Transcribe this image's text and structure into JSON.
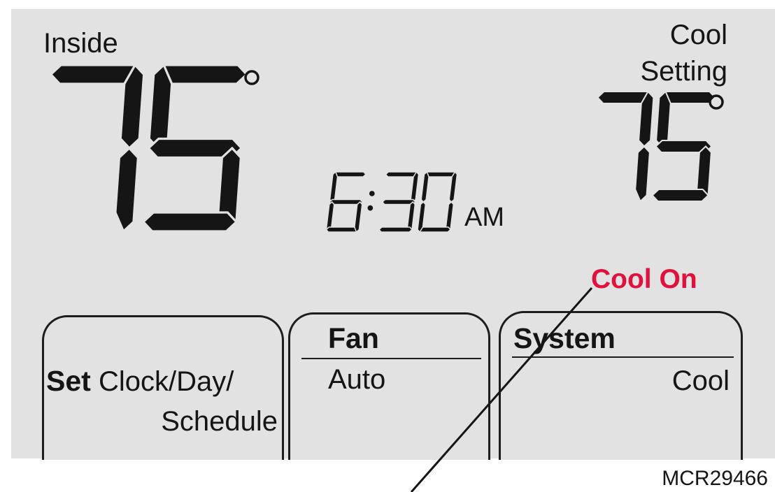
{
  "inside": {
    "label": "Inside",
    "temperature": "75",
    "degree_symbol": "°"
  },
  "cool_setting": {
    "label_line1": "Cool",
    "label_line2": "Setting",
    "temperature": "75",
    "degree_symbol": "°"
  },
  "clock": {
    "time": "6:30",
    "meridiem": "AM"
  },
  "status": {
    "text": "Cool On",
    "color": "#e0113c"
  },
  "softkeys": {
    "set": {
      "bold": "Set",
      "line1": "Clock/Day/",
      "line2": "Schedule"
    },
    "fan": {
      "title": "Fan",
      "value": "Auto"
    },
    "system": {
      "title": "System",
      "value": "Cool"
    }
  },
  "figure_code": "MCR29466",
  "colors": {
    "screen_background": "#e2e2e2",
    "segment": "#151515",
    "status_text": "#e0113c"
  }
}
